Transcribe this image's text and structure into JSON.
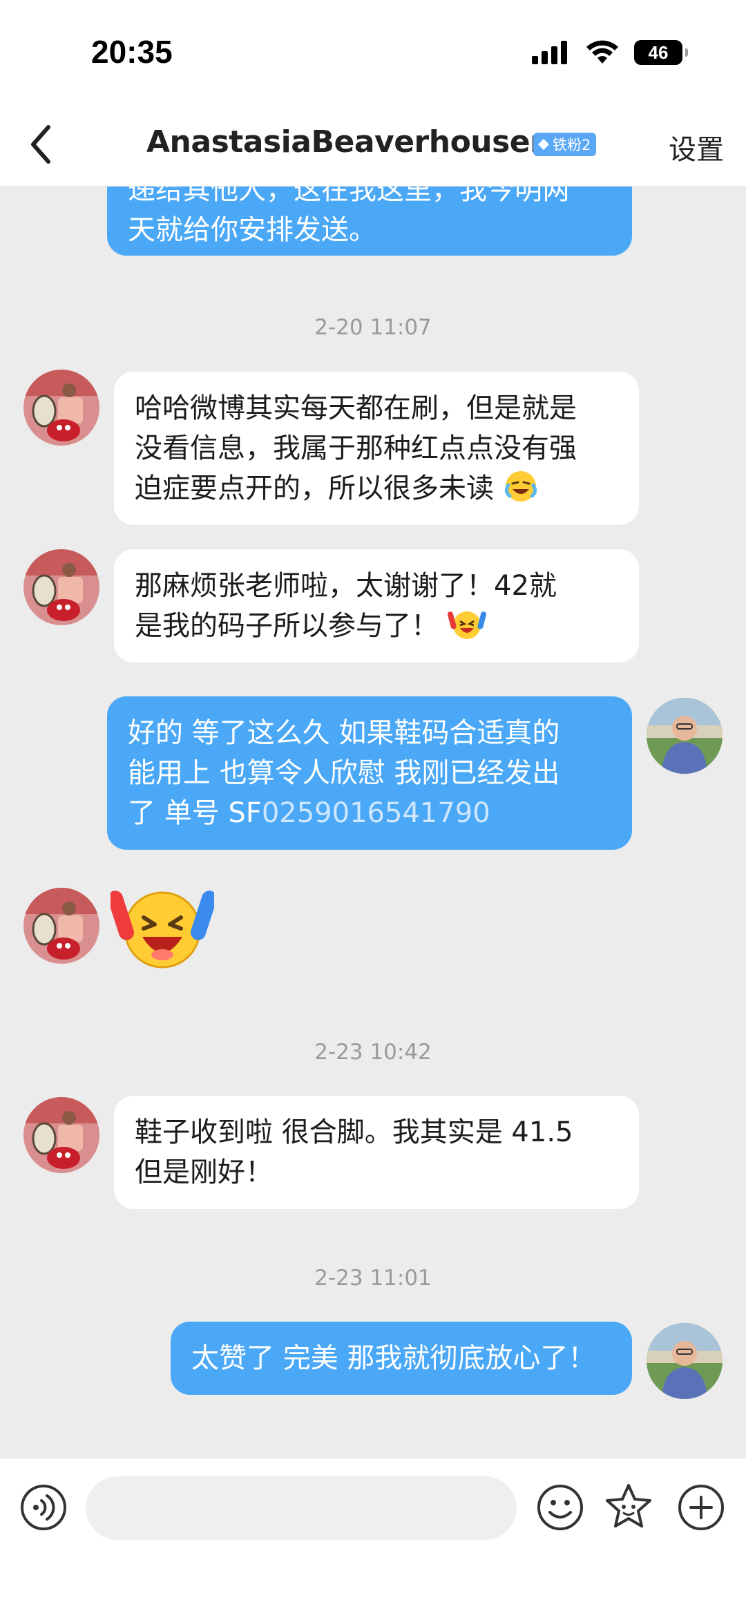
{
  "status_bar": {
    "time": "20:35",
    "battery": "46"
  },
  "nav": {
    "title": "AnastasiaBeaverhousenn",
    "badge": "铁粉2",
    "settings": "设置"
  },
  "messages": {
    "partial_top": "递给其他人，这在我这里，我今明两",
    "partial_bottom": "天就给你安排发送。",
    "ts1": "2-20 11:07",
    "m1_l1": "哈哈微博其实每天都在刷，但是就是",
    "m1_l2": "没看信息，我属于那种红点点没有强",
    "m1_l3": "迫症要点开的，所以很多未读",
    "m2_l1": "那麻烦张老师啦，太谢谢了！42就",
    "m2_l2": "是我的码子所以参与了！",
    "m3_l1": "好的 等了这么久 如果鞋码合适真的",
    "m3_l2": "能用上 也算令人欣慰 我刚已经发出",
    "m3_l3_prefix": "了 单号 SF",
    "m3_l3_number": "0259016541790",
    "ts2": "2-23 10:42",
    "m5_l1": "鞋子收到啦 很合脚。我其实是 41.5",
    "m5_l2": "但是刚好！",
    "ts3": "2-23 11:01",
    "m6": "太赞了 完美 那我就彻底放心了！"
  },
  "input": {
    "placeholder": ""
  },
  "icons": {
    "back": "back-arrow-icon",
    "voice": "voice-icon",
    "emoji": "emoji-smile-icon",
    "sticker": "sticker-star-icon",
    "plus": "plus-icon"
  },
  "colors": {
    "outgoing_bubble": "#4aa8f7",
    "incoming_bubble": "#ffffff",
    "chat_bg": "#ececec",
    "badge": "#5aa8f5"
  }
}
